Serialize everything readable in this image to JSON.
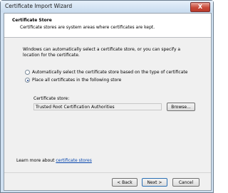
{
  "window": {
    "title": "Certificate Import Wizard",
    "close_label": "X"
  },
  "header": {
    "title": "Certificate Store",
    "subtitle": "Certificate stores are system areas where certificates are kept."
  },
  "body": {
    "intro": "Windows can automatically select a certificate store, or you can specify a location for the certificate.",
    "options": [
      {
        "label": "Automatically select the certificate store based on the type of certificate",
        "selected": false
      },
      {
        "label": "Place all certificates in the following store",
        "selected": true
      }
    ],
    "store_label": "Certificate store:",
    "store_value": "Trusted Root Certification Authorities",
    "browse_label": "Browse..."
  },
  "footer": {
    "learn_prefix": "Learn more about ",
    "learn_link": "certificate stores",
    "back_label": "< Back",
    "next_label": "Next >",
    "cancel_label": "Cancel"
  }
}
